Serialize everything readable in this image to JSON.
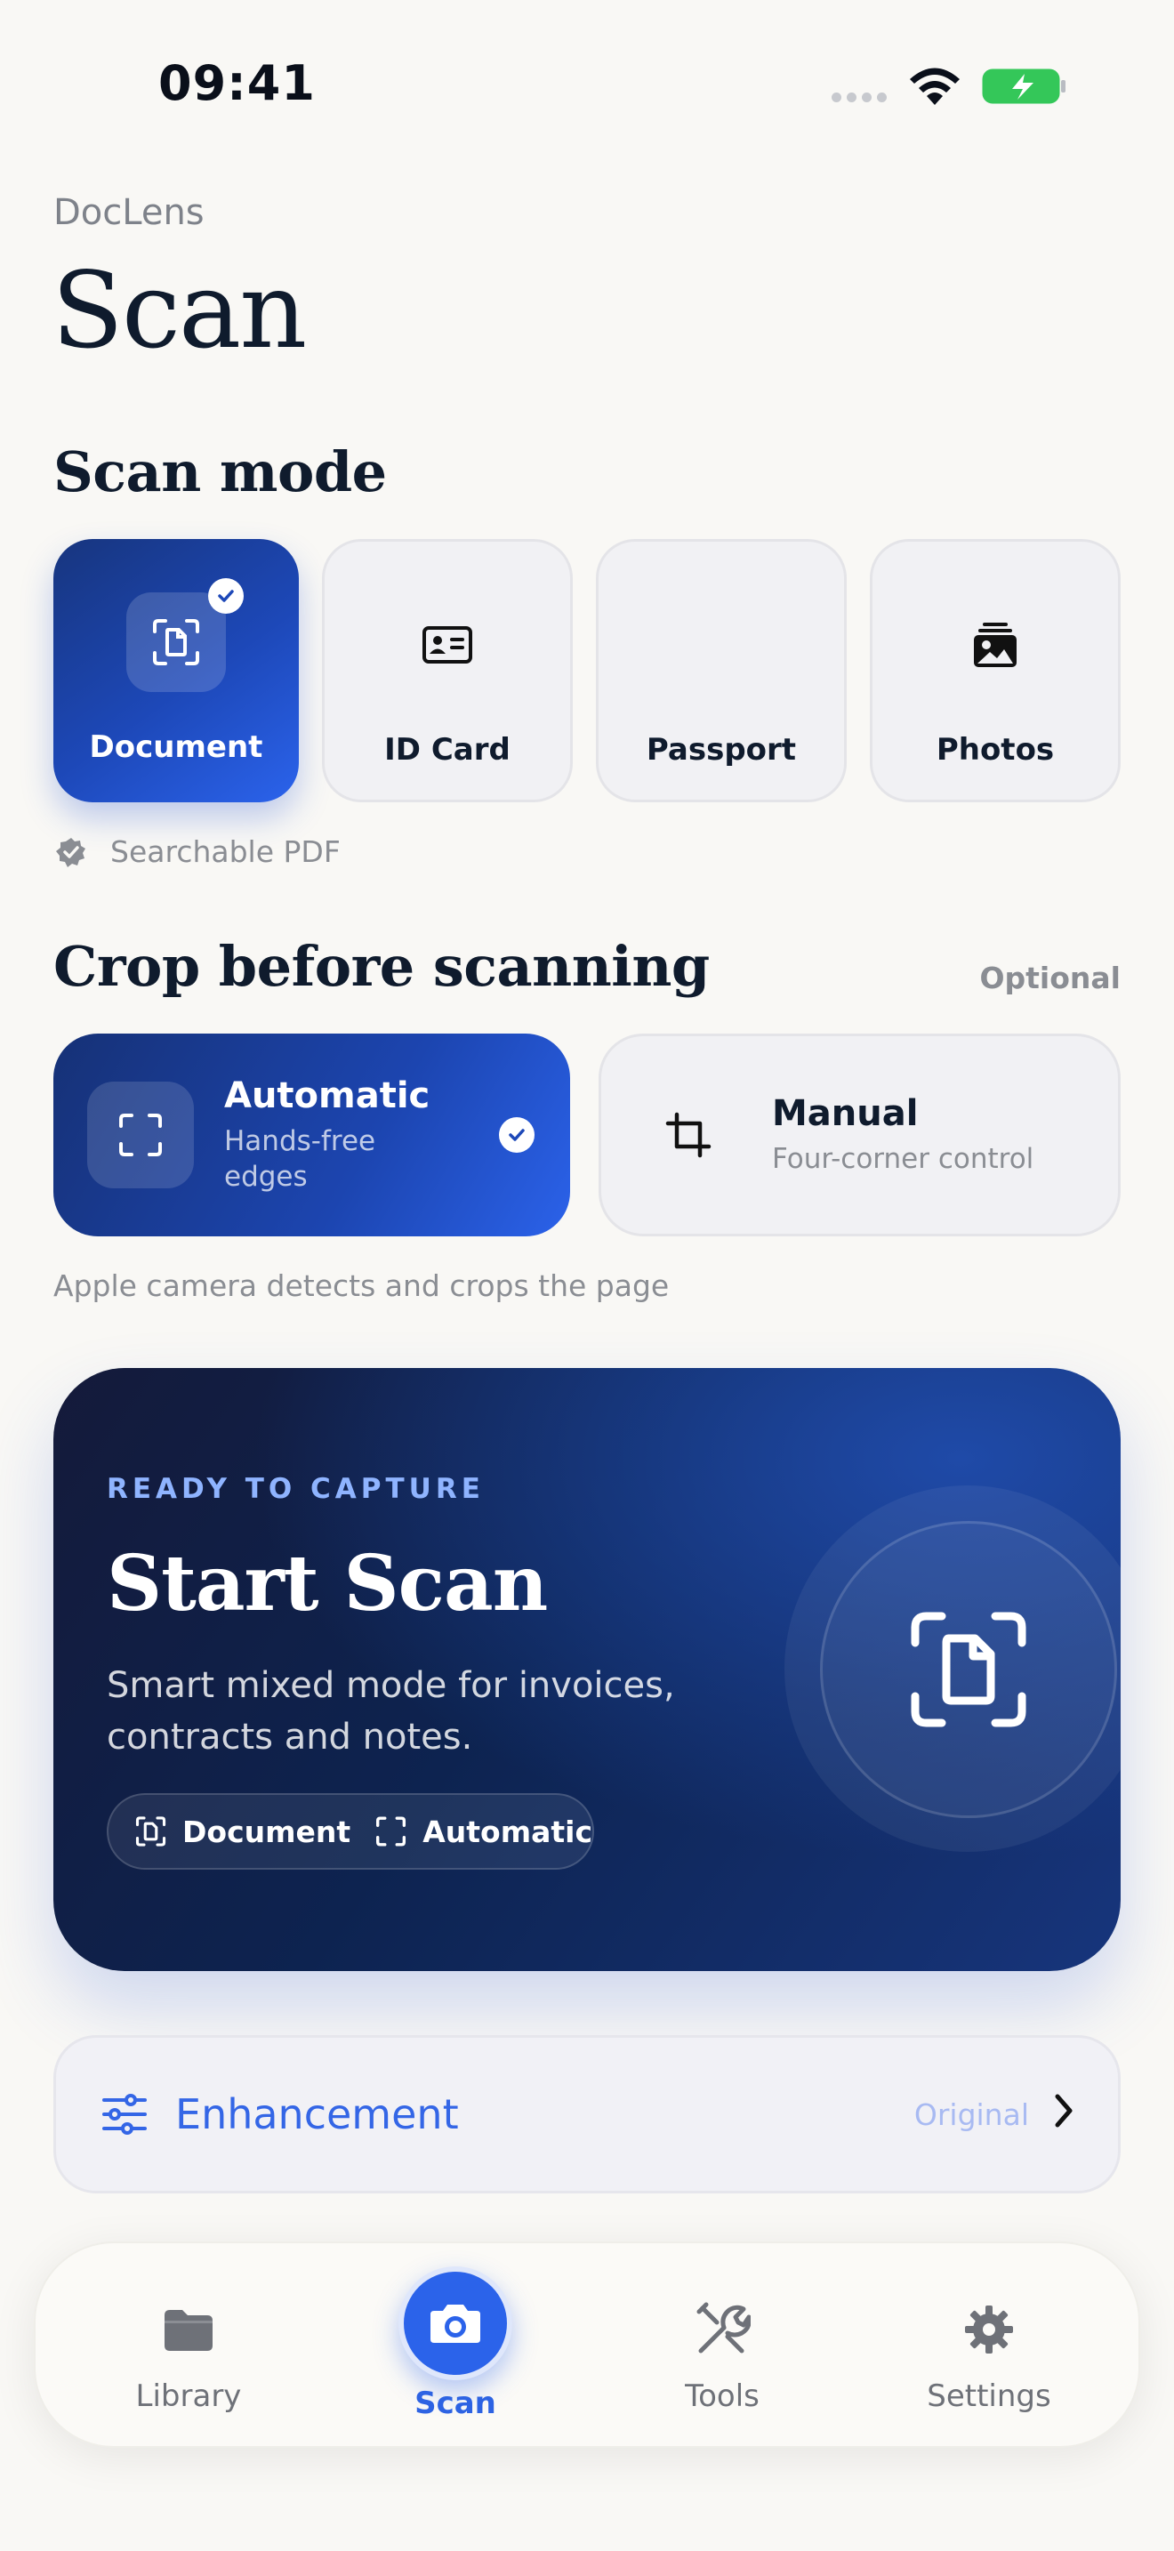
{
  "status_bar": {
    "time": "09:41"
  },
  "header": {
    "app_name": "DocLens",
    "title": "Scan"
  },
  "scan_mode": {
    "title": "Scan mode",
    "options": [
      {
        "label": "Document",
        "icon": "document-scan-icon",
        "selected": true
      },
      {
        "label": "ID Card",
        "icon": "id-card-icon",
        "selected": false
      },
      {
        "label": "Passport",
        "icon": "passport-icon",
        "selected": false
      },
      {
        "label": "Photos",
        "icon": "photos-icon",
        "selected": false
      }
    ],
    "hint": "Searchable PDF"
  },
  "crop": {
    "title": "Crop before scanning",
    "badge": "Optional",
    "options": [
      {
        "title": "Automatic",
        "subtitle": "Hands-free edges",
        "selected": true
      },
      {
        "title": "Manual",
        "subtitle": "Four-corner control",
        "selected": false
      }
    ],
    "caption": "Apple camera detects and crops the page"
  },
  "hero": {
    "kicker": "READY TO CAPTURE",
    "title": "Start Scan",
    "description": "Smart mixed mode for invoices, contracts and notes.",
    "chip_mode": "Document",
    "chip_crop": "Automatic"
  },
  "enhancement": {
    "label": "Enhancement",
    "value": "Original"
  },
  "tabbar": {
    "items": [
      {
        "label": "Library"
      },
      {
        "label": "Scan"
      },
      {
        "label": "Tools"
      },
      {
        "label": "Settings"
      }
    ]
  },
  "colors": {
    "accent": "#2b63ea",
    "navy": "#0f1b2d",
    "background": "#f9f8f5"
  }
}
